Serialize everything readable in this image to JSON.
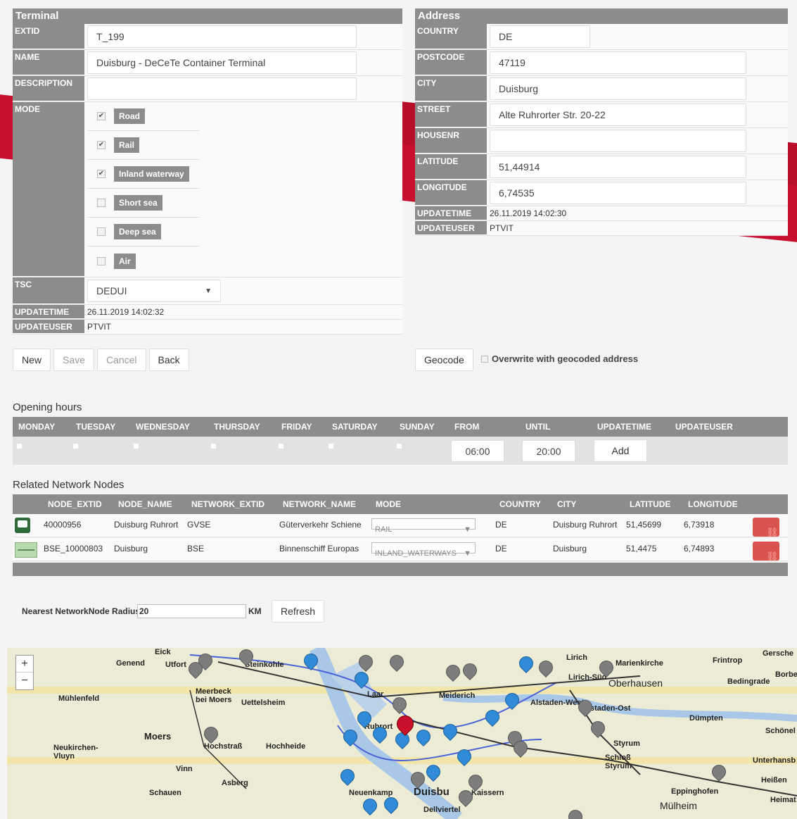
{
  "terminal": {
    "title": "Terminal",
    "labels": {
      "extid": "EXTID",
      "name": "NAME",
      "description": "DESCRIPTION",
      "mode": "MODE",
      "tsc": "TSC",
      "updatetime": "UPDATETIME",
      "updateuser": "UPDATEUSER"
    },
    "extid": "T_199",
    "name": "Duisburg - DeCeTe Container Terminal",
    "description": "",
    "modes": [
      {
        "label": "Road",
        "checked": true
      },
      {
        "label": "Rail",
        "checked": true
      },
      {
        "label": "Inland waterway",
        "checked": true
      },
      {
        "label": "Short sea",
        "checked": false
      },
      {
        "label": "Deep sea",
        "checked": false
      },
      {
        "label": "Air",
        "checked": false
      }
    ],
    "tsc": "DEDUI",
    "updatetime": "26.11.2019 14:02:32",
    "updateuser": "PTVIT"
  },
  "address": {
    "title": "Address",
    "labels": {
      "country": "COUNTRY",
      "postcode": "POSTCODE",
      "city": "CITY",
      "street": "STREET",
      "housenr": "HOUSENR",
      "latitude": "LATITUDE",
      "longitude": "LONGITUDE",
      "updatetime": "UPDATETIME",
      "updateuser": "UPDATEUSER"
    },
    "country": "DE",
    "postcode": "47119",
    "city": "Duisburg",
    "street": "Alte Ruhrorter Str. 20-22",
    "housenr": "",
    "latitude": "51,44914",
    "longitude": "6,74535",
    "updatetime": "26.11.2019 14:02:30",
    "updateuser": "PTVIT"
  },
  "buttons": {
    "new": "New",
    "save": "Save",
    "cancel": "Cancel",
    "back": "Back",
    "geocode": "Geocode",
    "overwrite": "Overwrite with geocoded address",
    "add": "Add",
    "refresh": "Refresh"
  },
  "opening": {
    "title": "Opening hours",
    "headers": [
      "MONDAY",
      "TUESDAY",
      "WEDNESDAY",
      "THURSDAY",
      "FRIDAY",
      "SATURDAY",
      "SUNDAY",
      "FROM",
      "UNTIL",
      "UPDATETIME",
      "UPDATEUSER"
    ],
    "from": "06:00",
    "until": "20:00"
  },
  "nodes": {
    "title": "Related Network Nodes",
    "headers": [
      "NODE_EXTID",
      "NODE_NAME",
      "NETWORK_EXTID",
      "NETWORK_NAME",
      "MODE",
      "COUNTRY",
      "CITY",
      "LATITUDE",
      "LONGITUDE"
    ],
    "rows": [
      {
        "extid": "40000956",
        "name": "Duisburg Ruhrort",
        "net_extid": "GVSE",
        "net_name": "Güterverkehr Schiene",
        "mode": "RAIL",
        "country": "DE",
        "city": "Duisburg Ruhrort",
        "lat": "51,45699",
        "lon": "6,73918"
      },
      {
        "extid": "BSE_10000803",
        "name": "Duisburg",
        "net_extid": "BSE",
        "net_name": "Binnenschiff Europas",
        "mode": "INLAND_WATERWAYS",
        "country": "DE",
        "city": "Duisburg",
        "lat": "51,4475",
        "lon": "6,74893"
      }
    ]
  },
  "radius": {
    "label": "Nearest NetworkNode Radius:",
    "value": "20",
    "unit": "KM"
  },
  "map": {
    "labels": [
      "Genend",
      "Steinkohle",
      "Meerbeck bei Moers",
      "Uettelsheim",
      "Mühlenfeld",
      "Moers",
      "Neukirchen-Vluyn",
      "Hochheide",
      "Vinn",
      "Asberg",
      "Schauen",
      "Laar",
      "Meiderich",
      "Ruhrort",
      "Neuenkamp",
      "Duisbu",
      "Kaissern",
      "Dellviertel",
      "Alstaden-West",
      "Alstaden-Ost",
      "Oberhausen",
      "Marienkirche",
      "Lirich",
      "Lirich-Süd",
      "Dümpten",
      "Styrum",
      "Schloß Styrum",
      "Eppinghofen",
      "Mülheim",
      "Frintrop",
      "Bedingrade",
      "Gersche",
      "Schönel",
      "Unterhansb",
      "Heißen",
      "Heimat",
      "Borbe",
      "Utfort",
      "Hochstraß",
      "Eick"
    ],
    "zoom_in": "+",
    "zoom_out": "−"
  }
}
